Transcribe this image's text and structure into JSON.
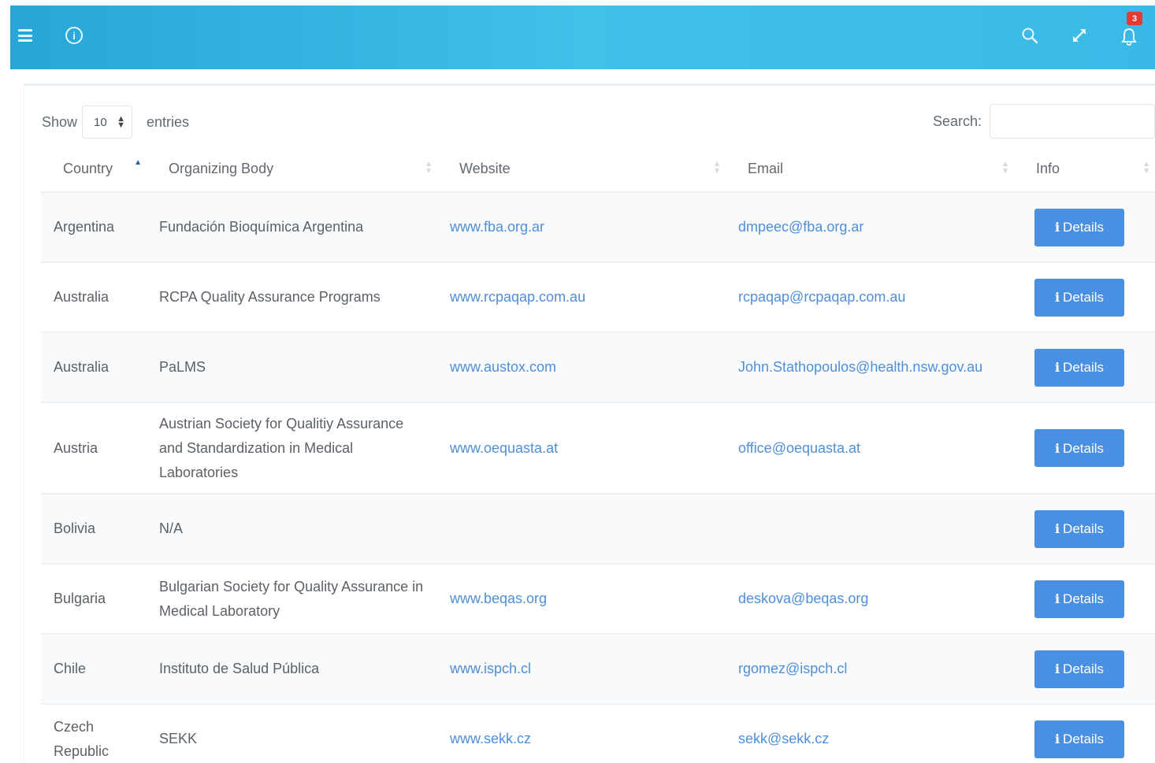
{
  "header": {
    "notification_count": "3",
    "icons": [
      "menu-icon",
      "info-icon",
      "search-icon",
      "expand-icon",
      "bell-icon"
    ],
    "colors": {
      "topbar_start": "#27a6d8",
      "topbar_end": "#3ab9e6",
      "badge": "#e53935"
    }
  },
  "controls": {
    "show_label": "Show",
    "page_size": "10",
    "entries_label": "entries",
    "search_label": "Search:",
    "search_value": ""
  },
  "table": {
    "columns": [
      "Country",
      "Organizing Body",
      "Website",
      "Email",
      "Info"
    ],
    "sorted_column": "Country",
    "details_label": "Details",
    "rows": [
      {
        "country": "Argentina",
        "body": "Fundación Bioquímica Argentina",
        "website": "www.fba.org.ar",
        "email": "dmpeec@fba.org.ar"
      },
      {
        "country": "Australia",
        "body": "RCPA Quality Assurance Programs",
        "website": "www.rcpaqap.com.au",
        "email": "rcpaqap@rcpaqap.com.au"
      },
      {
        "country": "Australia",
        "body": "PaLMS",
        "website": "www.austox.com",
        "email": "John.Stathopoulos@health.nsw.gov.au"
      },
      {
        "country": "Austria",
        "body": "Austrian Society for Qualitiy Assurance and Standardization in Medical Laboratories",
        "website": "www.oequasta.at",
        "email": "office@oequasta.at"
      },
      {
        "country": "Bolivia",
        "body": "N/A",
        "website": "",
        "email": ""
      },
      {
        "country": "Bulgaria",
        "body": "Bulgarian Society for Quality Assurance in Medical Laboratory",
        "website": "www.beqas.org",
        "email": "deskova@beqas.org"
      },
      {
        "country": "Chile",
        "body": "Instituto de Salud Pública",
        "website": "www.ispch.cl",
        "email": "rgomez@ispch.cl"
      },
      {
        "country": "Czech Republic",
        "body": "SEKK",
        "website": "www.sekk.cz",
        "email": "sekk@sekk.cz"
      }
    ]
  }
}
